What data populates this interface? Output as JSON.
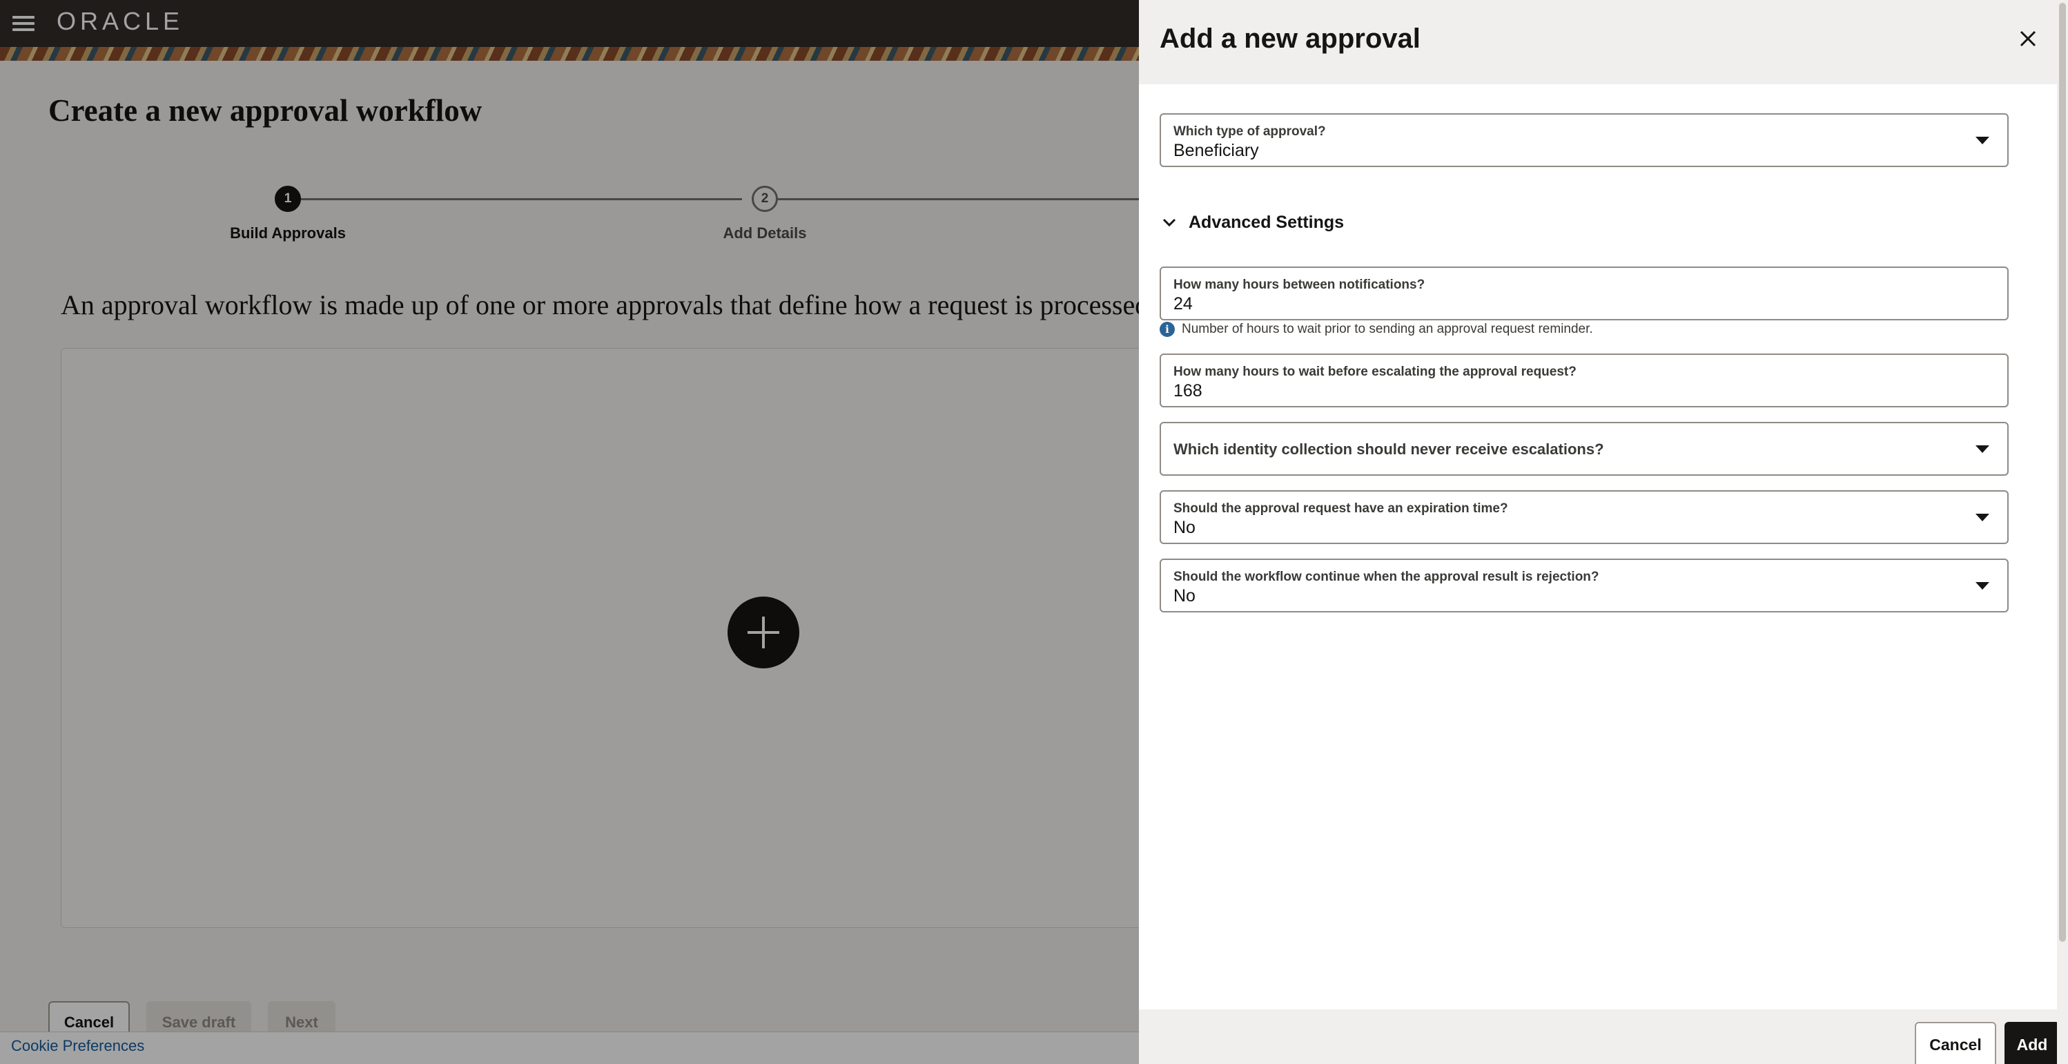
{
  "header": {
    "brand": "ORACLE"
  },
  "page": {
    "title": "Create a new approval workflow",
    "description": "An approval workflow is made up of one or more approvals that define how a request is processed."
  },
  "stepper": {
    "steps": [
      {
        "number": "1",
        "label": "Build Approvals",
        "active": true
      },
      {
        "number": "2",
        "label": "Add Details",
        "active": false
      }
    ]
  },
  "actions": {
    "cancel": "Cancel",
    "save_draft": "Save draft",
    "next": "Next"
  },
  "footer": {
    "cookie_preferences": "Cookie Preferences"
  },
  "drawer": {
    "title": "Add a new approval",
    "approval_type": {
      "label": "Which type of approval?",
      "value": "Beneficiary"
    },
    "advanced_settings_label": "Advanced Settings",
    "notification_hours": {
      "label": "How many hours between notifications?",
      "value": "24",
      "helper": "Number of hours to wait prior to sending an approval request reminder."
    },
    "escalation_hours": {
      "label": "How many hours to wait before escalating the approval request?",
      "value": "168"
    },
    "escalation_exclusion": {
      "placeholder": "Which identity collection should never receive escalations?"
    },
    "expiration": {
      "label": "Should the approval request have an expiration time?",
      "value": "No"
    },
    "continue_on_rejection": {
      "label": "Should the workflow continue when the approval result is rejection?",
      "value": "No"
    },
    "buttons": {
      "cancel": "Cancel",
      "add": "Add"
    }
  },
  "colors": {
    "accent": "#161513",
    "header_bg": "#312d2a",
    "info": "#2a6496",
    "link": "#145c9e"
  }
}
